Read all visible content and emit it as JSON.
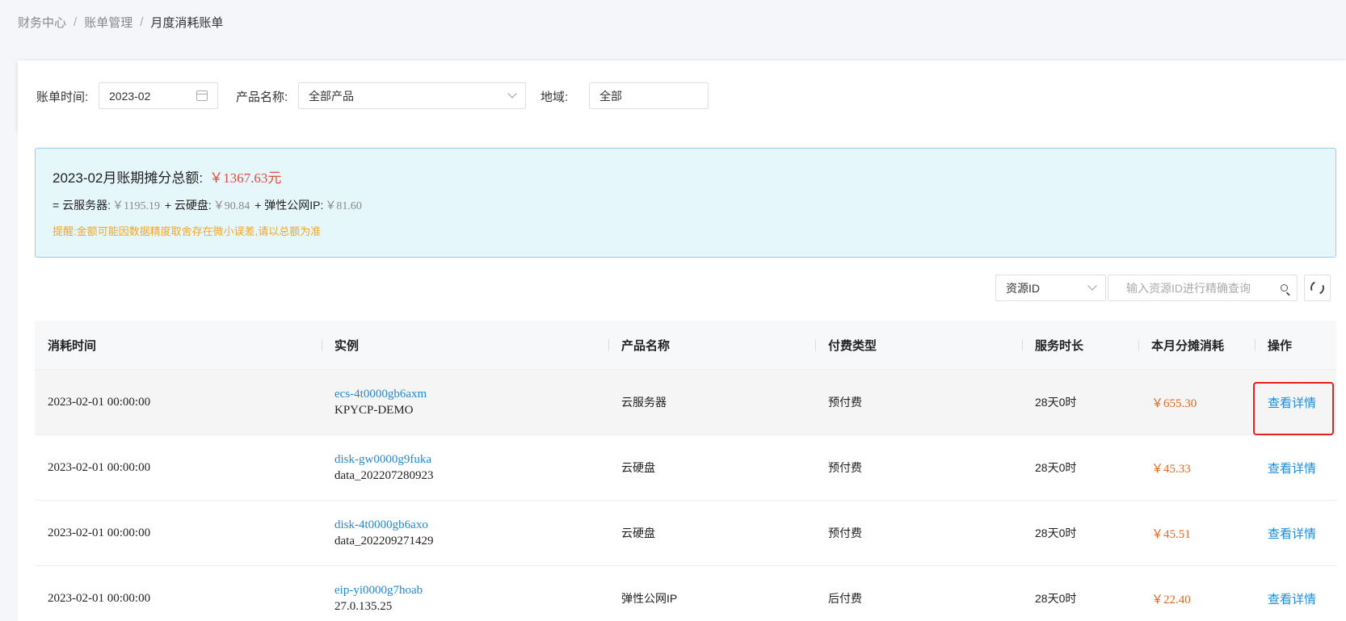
{
  "breadcrumb": {
    "items": [
      "财务中心",
      "账单管理"
    ],
    "separator": "/",
    "current": "月度消耗账单"
  },
  "filters": {
    "bill_time_label": "账单时间:",
    "bill_time_value": "2023-02",
    "product_label": "产品名称:",
    "product_value": "全部产品",
    "region_label": "地域:",
    "region_value": "全部"
  },
  "summary": {
    "title": "2023-02月账期摊分总额:",
    "total": "￥1367.63元",
    "eq": "=",
    "plus": "+",
    "ecs_label": "云服务器:",
    "ecs_value": "￥1195.19",
    "disk_label": "云硬盘:",
    "disk_value": "￥90.84",
    "eip_label": "弹性公网IP:",
    "eip_value": "￥81.60",
    "notice": "提醒:金额可能因数据精度取舍存在微小误差,请以总额为准"
  },
  "search": {
    "field_select": "资源ID",
    "placeholder": "输入资源ID进行精确查询"
  },
  "table": {
    "headers": [
      "消耗时间",
      "实例",
      "产品名称",
      "付费类型",
      "服务时长",
      "本月分摊消耗",
      "操作"
    ],
    "rows": [
      {
        "time": "2023-02-01 00:00:00",
        "instance_id": "ecs-4t0000gb6axm",
        "instance_name": "KPYCP-DEMO",
        "product": "云服务器",
        "pay_type": "预付费",
        "duration": "28天0时",
        "cost": "￥655.30",
        "action": "查看详情"
      },
      {
        "time": "2023-02-01 00:00:00",
        "instance_id": "disk-gw0000g9fuka",
        "instance_name": "data_202207280923",
        "product": "云硬盘",
        "pay_type": "预付费",
        "duration": "28天0时",
        "cost": "￥45.33",
        "action": "查看详情"
      },
      {
        "time": "2023-02-01 00:00:00",
        "instance_id": "disk-4t0000gb6axo",
        "instance_name": "data_202209271429",
        "product": "云硬盘",
        "pay_type": "预付费",
        "duration": "28天0时",
        "cost": "￥45.51",
        "action": "查看详情"
      },
      {
        "time": "2023-02-01 00:00:00",
        "instance_id": "eip-yi0000g7hoab",
        "instance_name": "27.0.135.25",
        "product": "弹性公网IP",
        "pay_type": "后付费",
        "duration": "28天0时",
        "cost": "￥22.40",
        "action": "查看详情"
      }
    ]
  },
  "colors": {
    "link": "#1f8ad8",
    "money": "#e8671a",
    "total": "#e74c3c",
    "notice": "#f5a623",
    "highlight_box": "#e62020"
  }
}
